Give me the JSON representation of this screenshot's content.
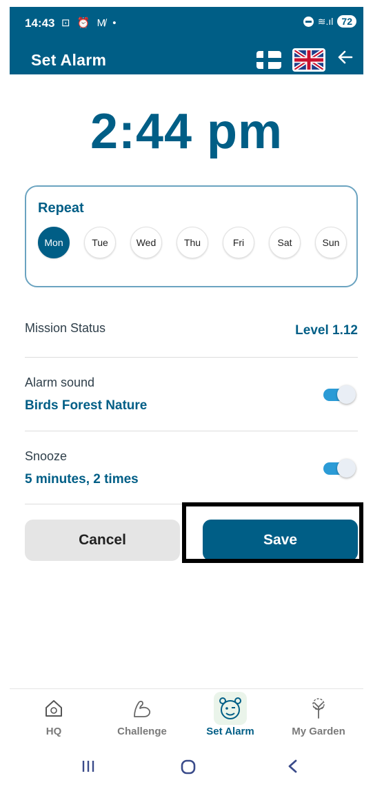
{
  "status_bar": {
    "time": "14:43",
    "left_icons": "⊡ ⏰ M̸ •",
    "battery": "72",
    "signal": "≋.ıl"
  },
  "header": {
    "title": "Set Alarm"
  },
  "alarm": {
    "time": "2:44 pm"
  },
  "repeat": {
    "label": "Repeat",
    "days": [
      {
        "label": "Mon",
        "selected": true
      },
      {
        "label": "Tue",
        "selected": false
      },
      {
        "label": "Wed",
        "selected": false
      },
      {
        "label": "Thu",
        "selected": false
      },
      {
        "label": "Fri",
        "selected": false
      },
      {
        "label": "Sat",
        "selected": false
      },
      {
        "label": "Sun",
        "selected": false
      }
    ]
  },
  "mission": {
    "label": "Mission Status",
    "value": "Level 1.12"
  },
  "alarm_sound": {
    "label": "Alarm sound",
    "value": "Birds Forest Nature",
    "enabled": true
  },
  "snooze": {
    "label": "Snooze",
    "value": "5 minutes, 2 times",
    "enabled": true
  },
  "buttons": {
    "cancel": "Cancel",
    "save": "Save"
  },
  "nav": {
    "items": [
      {
        "label": "HQ",
        "icon": "house-icon",
        "active": false
      },
      {
        "label": "Challenge",
        "icon": "arm-icon",
        "active": false
      },
      {
        "label": "Set Alarm",
        "icon": "alarm-mascot-icon",
        "active": true
      },
      {
        "label": "My Garden",
        "icon": "tree-icon",
        "active": false
      }
    ]
  },
  "colors": {
    "primary": "#005e86",
    "toggle": "#2b9bd6"
  }
}
